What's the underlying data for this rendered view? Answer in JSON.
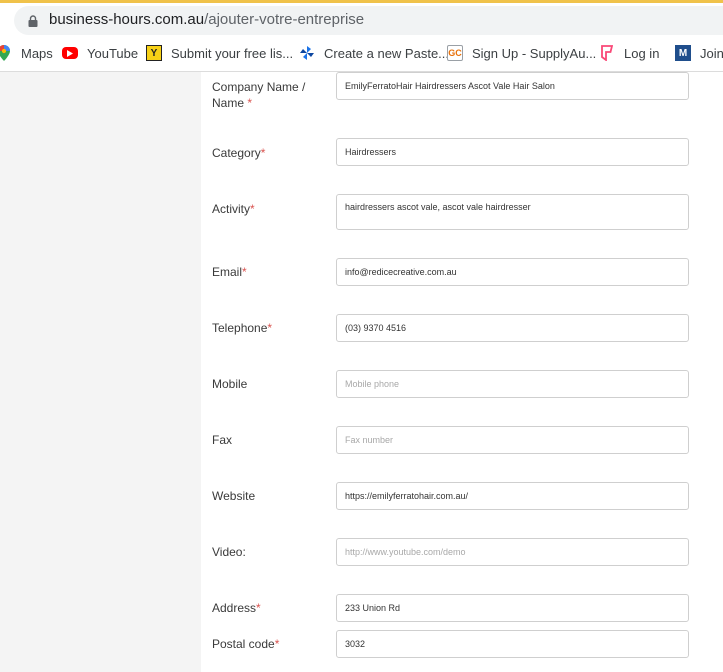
{
  "browser": {
    "url_domain": "business-hours.com.au",
    "url_path": "/ajouter-votre-entreprise",
    "bookmarks": [
      {
        "label": "Maps",
        "icon": "maps-pin-icon"
      },
      {
        "label": "YouTube",
        "icon": "youtube-icon"
      },
      {
        "label": "Submit your free lis...",
        "icon": "y-logo-icon"
      },
      {
        "label": "Create a new Paste...",
        "icon": "pinwheel-icon"
      },
      {
        "label": "Sign Up - SupplyAu...",
        "icon": "gc-logo-icon"
      },
      {
        "label": "Log in",
        "icon": "foursquare-icon"
      },
      {
        "label": "Join",
        "icon": "m-logo-icon"
      }
    ]
  },
  "form": {
    "company_label": "Company Name /",
    "company_label_2": "Name",
    "company_value": "EmilyFerratoHair Hairdressers Ascot Vale Hair Salon",
    "category_label": "Category",
    "category_value": "Hairdressers",
    "activity_label": "Activity",
    "activity_value": "hairdressers ascot vale, ascot vale hairdresser",
    "email_label": "Email",
    "email_value": "info@redicecreative.com.au",
    "telephone_label": "Telephone",
    "telephone_value": "(03) 9370 4516",
    "mobile_label": "Mobile",
    "mobile_placeholder": "Mobile phone",
    "fax_label": "Fax",
    "fax_placeholder": "Fax number",
    "website_label": "Website",
    "website_value": "https://emilyferratohair.com.au/",
    "video_label": "Video:",
    "video_placeholder": "http://www.youtube.com/demo",
    "address_label": "Address",
    "address_value": "233 Union Rd",
    "postal_label": "Postal code",
    "postal_value": "3032",
    "required_mark": "*"
  },
  "colors": {
    "required": "#d9534f",
    "page_bg": "#f4f4f4",
    "card_bg": "#ffffff",
    "input_border": "#cfcfcf"
  }
}
